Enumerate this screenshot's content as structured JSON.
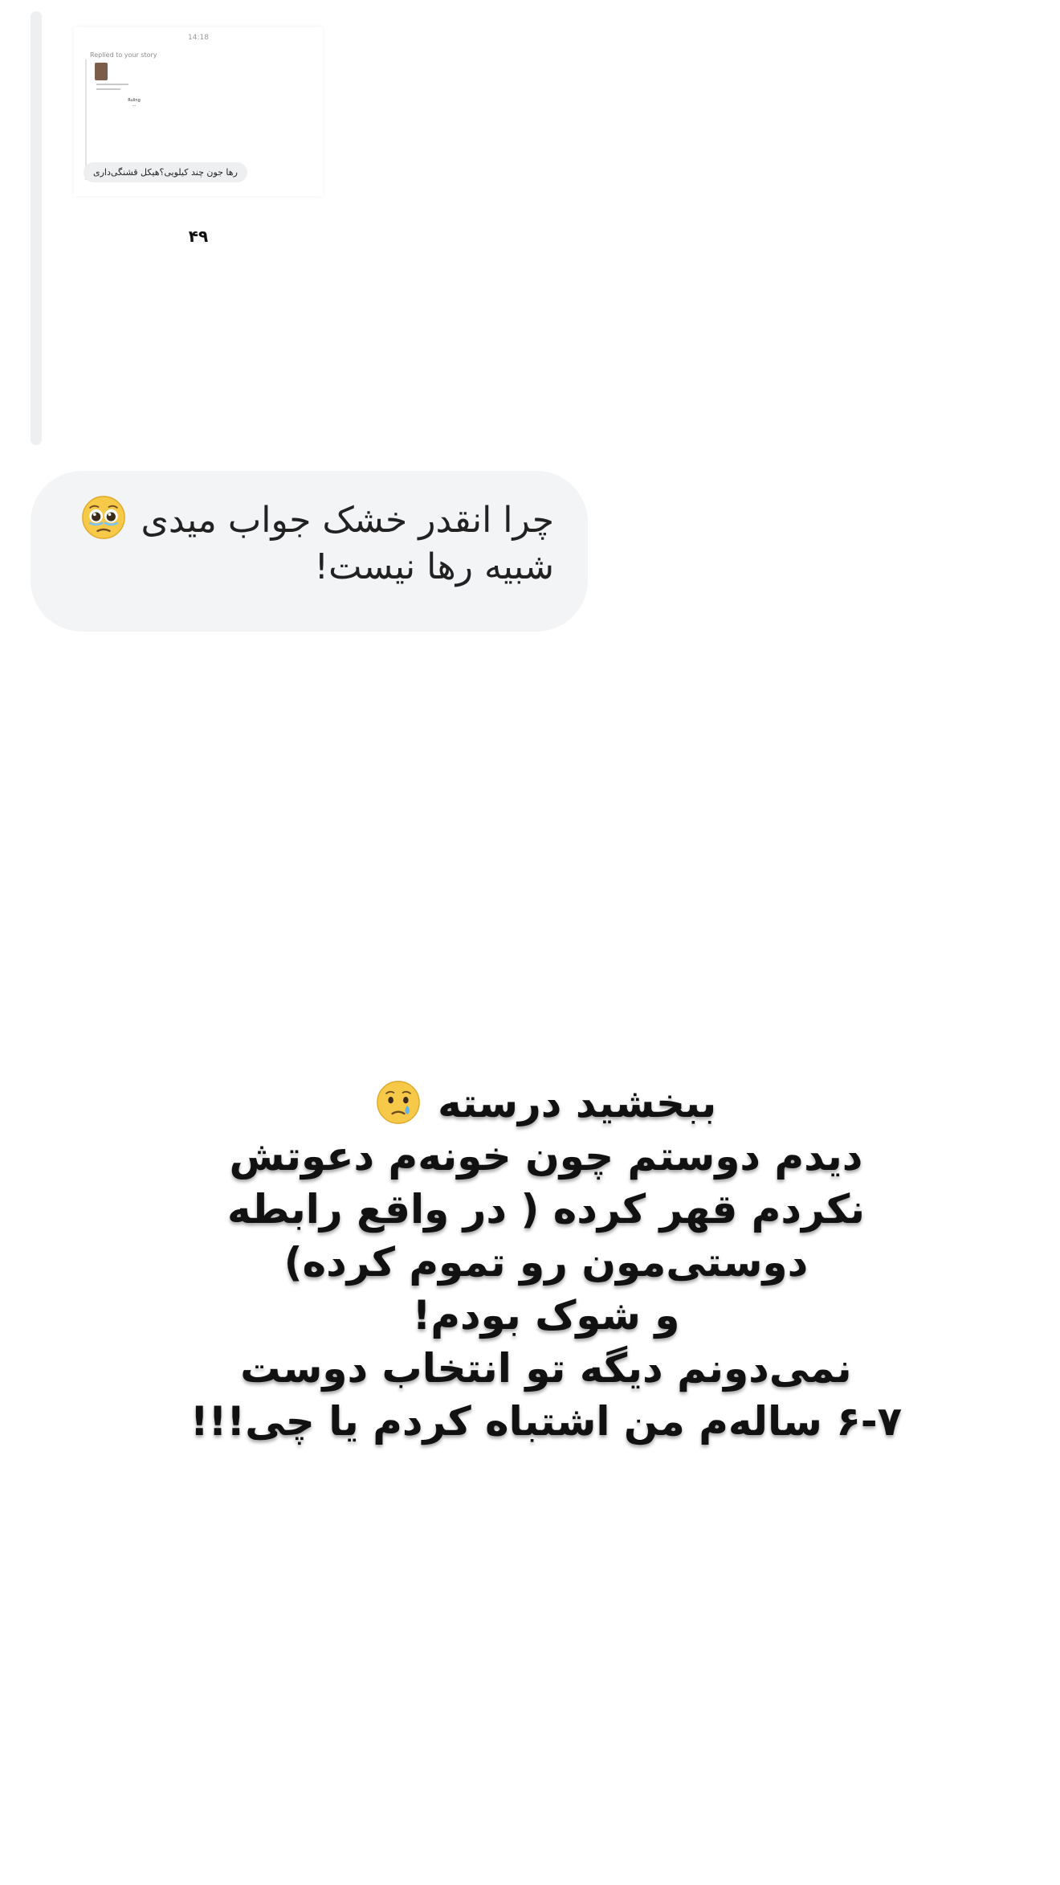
{
  "story_reply": {
    "time": "14:18",
    "replied_label": "Replied to your story",
    "story_line_1": "Ruling",
    "story_line_2": "...",
    "quoted_message": "رها جون چند کیلویی؟هیکل قشنگی‌داری"
  },
  "page_number": "۴۹",
  "message": {
    "line_1": "چرا انقدر خشک جواب میدی",
    "line_1_emoji": "face-holding-back-tears-icon",
    "line_2": "شبیه رها نیست!"
  },
  "caption": {
    "line_1": "ببخشید درسته",
    "line_1_emoji": "crying-face-icon",
    "line_2": "دیدم دوستم چون خونه‌م دعوتش",
    "line_3": "نکردم قهر کرده ( در واقع رابطه",
    "line_4": "دوستی‌مون رو تموم کرده)",
    "line_5": "و شوک بودم!",
    "line_6": "نمی‌دونم دیگه تو انتخاب دوست",
    "line_7": "۶-۷ ساله‌م من اشتباه کردم یا چی!!!"
  }
}
